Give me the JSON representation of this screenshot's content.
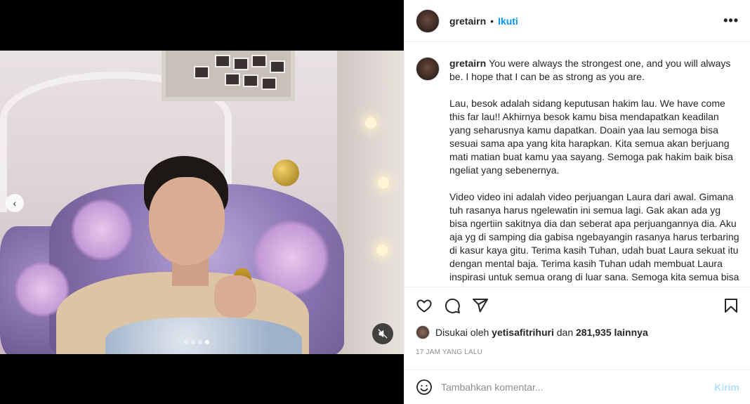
{
  "post": {
    "username": "gretairn",
    "separator": "•",
    "follow_label": "Ikuti",
    "more_label": "•••"
  },
  "caption": {
    "username": "gretairn",
    "paragraphs": [
      "You were always the strongest one, and you will always be. I hope that I can be as strong as you are.",
      "Lau, besok adalah sidang keputusan hakim lau. We have come this far lau!! Akhirnya besok kamu bisa mendapatkan keadilan yang seharusnya kamu dapatkan. Doain yaa lau semoga bisa sesuai sama apa yang kita harapkan. Kita semua akan berjuang mati matian buat kamu yaa sayang. Semoga pak hakim baik bisa ngeliat yang sebenernya.",
      "Video video ini adalah video perjuangan Laura dari awal. Gimana tuh rasanya harus ngelewatin ini semua lagi. Gak akan ada yg bisa ngertiin sakitnya dia dan seberat apa perjuangannya dia. Aku aja yg di samping dia gabisa ngebayangin rasanya harus terbaring di kasur kaya gitu. Terima kasih Tuhan, udah buat Laura sekuat itu dengan mental baja. Terima kasih Tuhan udah membuat Laura inspirasi untuk semua orang di luar sana. Semoga kita semua bisa belajar dari kamu ya Lau. Meskipun akhirnya kita harus kehilangan"
    ]
  },
  "likes": {
    "prefix": "Disukai oleh",
    "user": "yetisafitrihuri",
    "middle": "dan",
    "count": "281,935 lainnya"
  },
  "timestamp": "17 JAM YANG LALU",
  "comment": {
    "placeholder": "Tambahkan komentar...",
    "post_label": "Kirim"
  },
  "media": {
    "carousel_total": 4,
    "carousel_active": 4
  },
  "colors": {
    "accent": "#0095f6",
    "post_disabled": "#b2dffc",
    "muted_text": "#8e8e8e"
  },
  "icons": [
    "heart-icon",
    "comment-icon",
    "share-icon",
    "bookmark-icon",
    "emoji-icon",
    "chevron-left-icon",
    "mute-icon"
  ]
}
